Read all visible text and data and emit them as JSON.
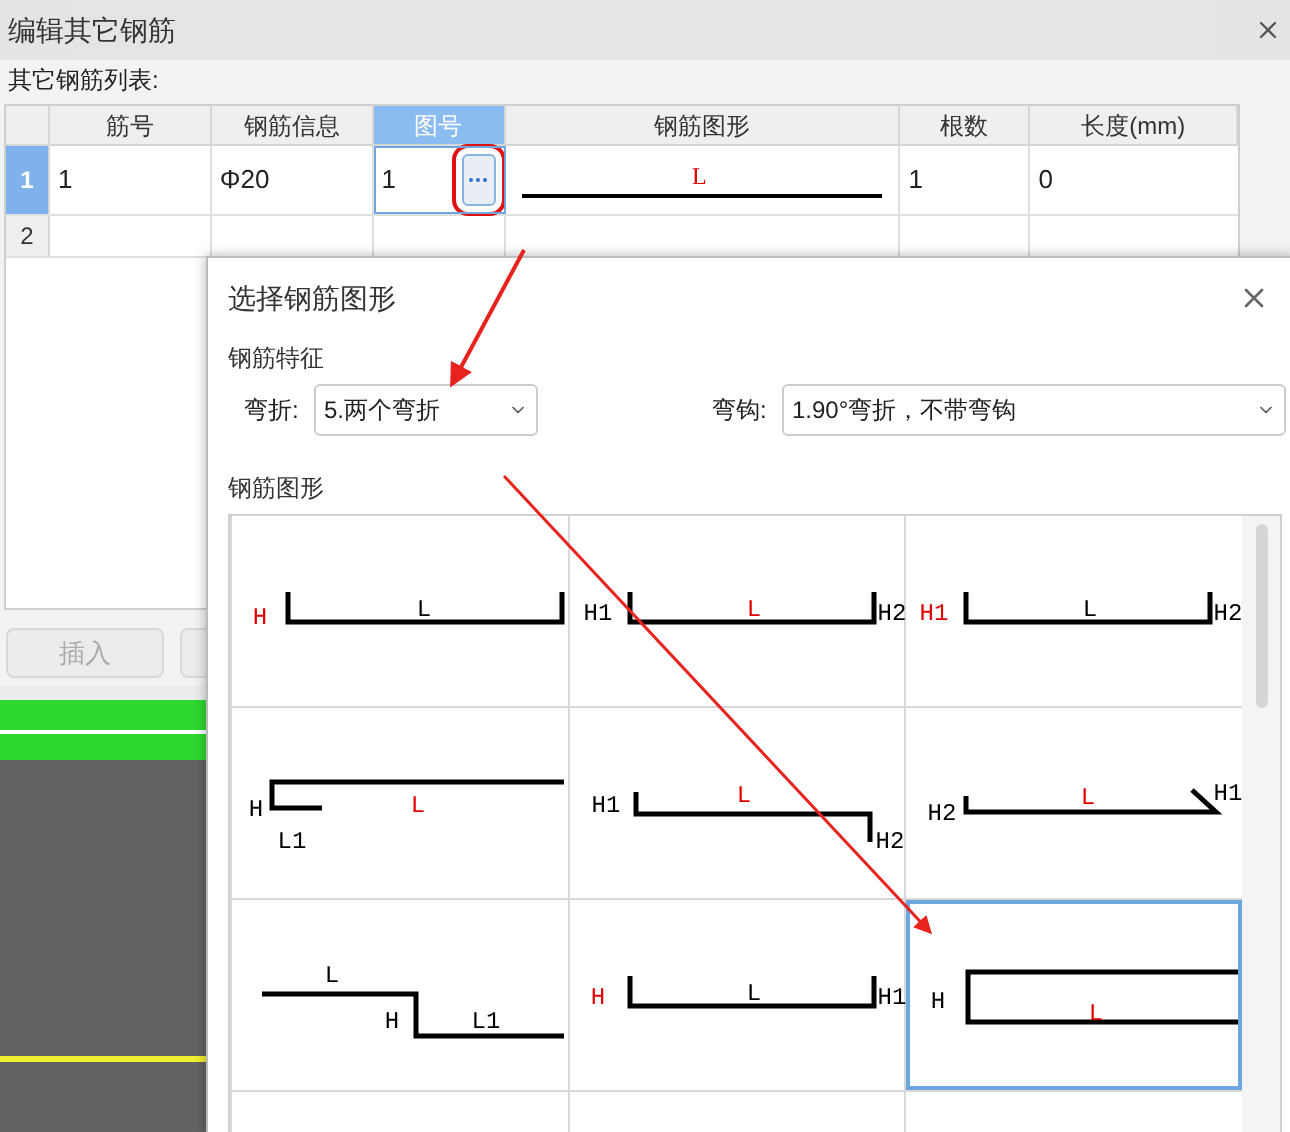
{
  "window": {
    "title": "编辑其它钢筋"
  },
  "list_label": "其它钢筋列表:",
  "table": {
    "columns": [
      {
        "label": "筋号",
        "selected": false
      },
      {
        "label": "钢筋信息",
        "selected": false
      },
      {
        "label": "图号",
        "selected": true
      },
      {
        "label": "钢筋图形",
        "selected": false
      },
      {
        "label": "根数",
        "selected": false
      },
      {
        "label": "长度(mm)",
        "selected": false
      }
    ],
    "rows": [
      {
        "number": "1",
        "selected": true,
        "bar_no": "1",
        "info": "Φ20",
        "shape_no": "1",
        "shape_label": "L",
        "count": "1",
        "length": "0"
      },
      {
        "number": "2",
        "selected": false
      }
    ]
  },
  "buttons": [
    {
      "label": "插入",
      "disabled": true
    }
  ],
  "dialog": {
    "title": "选择钢筋图形",
    "feature_label": "钢筋特征",
    "bend": {
      "label": "弯折:",
      "value": "5.两个弯折"
    },
    "hook": {
      "label": "弯钩:",
      "value": "1.90°弯折，不带弯钩"
    },
    "shapes_label": "钢筋图形",
    "shapes": [
      {
        "kind": "channel",
        "selected": false,
        "labels": [
          {
            "text": "H",
            "highlighted": true
          },
          {
            "text": "L",
            "highlighted": false
          }
        ]
      },
      {
        "kind": "channel_two",
        "selected": false,
        "labels": [
          {
            "text": "H1",
            "highlighted": false
          },
          {
            "text": "L",
            "highlighted": true
          },
          {
            "text": "H2",
            "highlighted": false
          }
        ]
      },
      {
        "kind": "channel_two",
        "selected": false,
        "labels": [
          {
            "text": "H1",
            "highlighted": true
          },
          {
            "text": "L",
            "highlighted": false
          },
          {
            "text": "H2",
            "highlighted": false
          }
        ]
      },
      {
        "kind": "hook_left",
        "selected": false,
        "labels": [
          {
            "text": "H",
            "highlighted": false
          },
          {
            "text": "L",
            "highlighted": true
          },
          {
            "text": "L1",
            "highlighted": false
          }
        ]
      },
      {
        "kind": "step_down",
        "selected": false,
        "labels": [
          {
            "text": "H1",
            "highlighted": false
          },
          {
            "text": "L",
            "highlighted": true
          },
          {
            "text": "H2",
            "highlighted": false
          }
        ]
      },
      {
        "kind": "bent_end",
        "selected": false,
        "labels": [
          {
            "text": "H2",
            "highlighted": false
          },
          {
            "text": "L",
            "highlighted": true
          },
          {
            "text": "H1",
            "highlighted": false
          }
        ]
      },
      {
        "kind": "z_step",
        "selected": false,
        "labels": [
          {
            "text": "L",
            "highlighted": false
          },
          {
            "text": "H",
            "highlighted": false
          },
          {
            "text": "L1",
            "highlighted": false
          }
        ]
      },
      {
        "kind": "channel_two",
        "selected": false,
        "labels": [
          {
            "text": "H",
            "highlighted": true
          },
          {
            "text": "L",
            "highlighted": false
          },
          {
            "text": "H1",
            "highlighted": false
          }
        ]
      },
      {
        "kind": "open_bracket",
        "selected": true,
        "labels": [
          {
            "text": "H",
            "highlighted": false
          },
          {
            "text": "L",
            "highlighted": true
          }
        ]
      }
    ]
  }
}
